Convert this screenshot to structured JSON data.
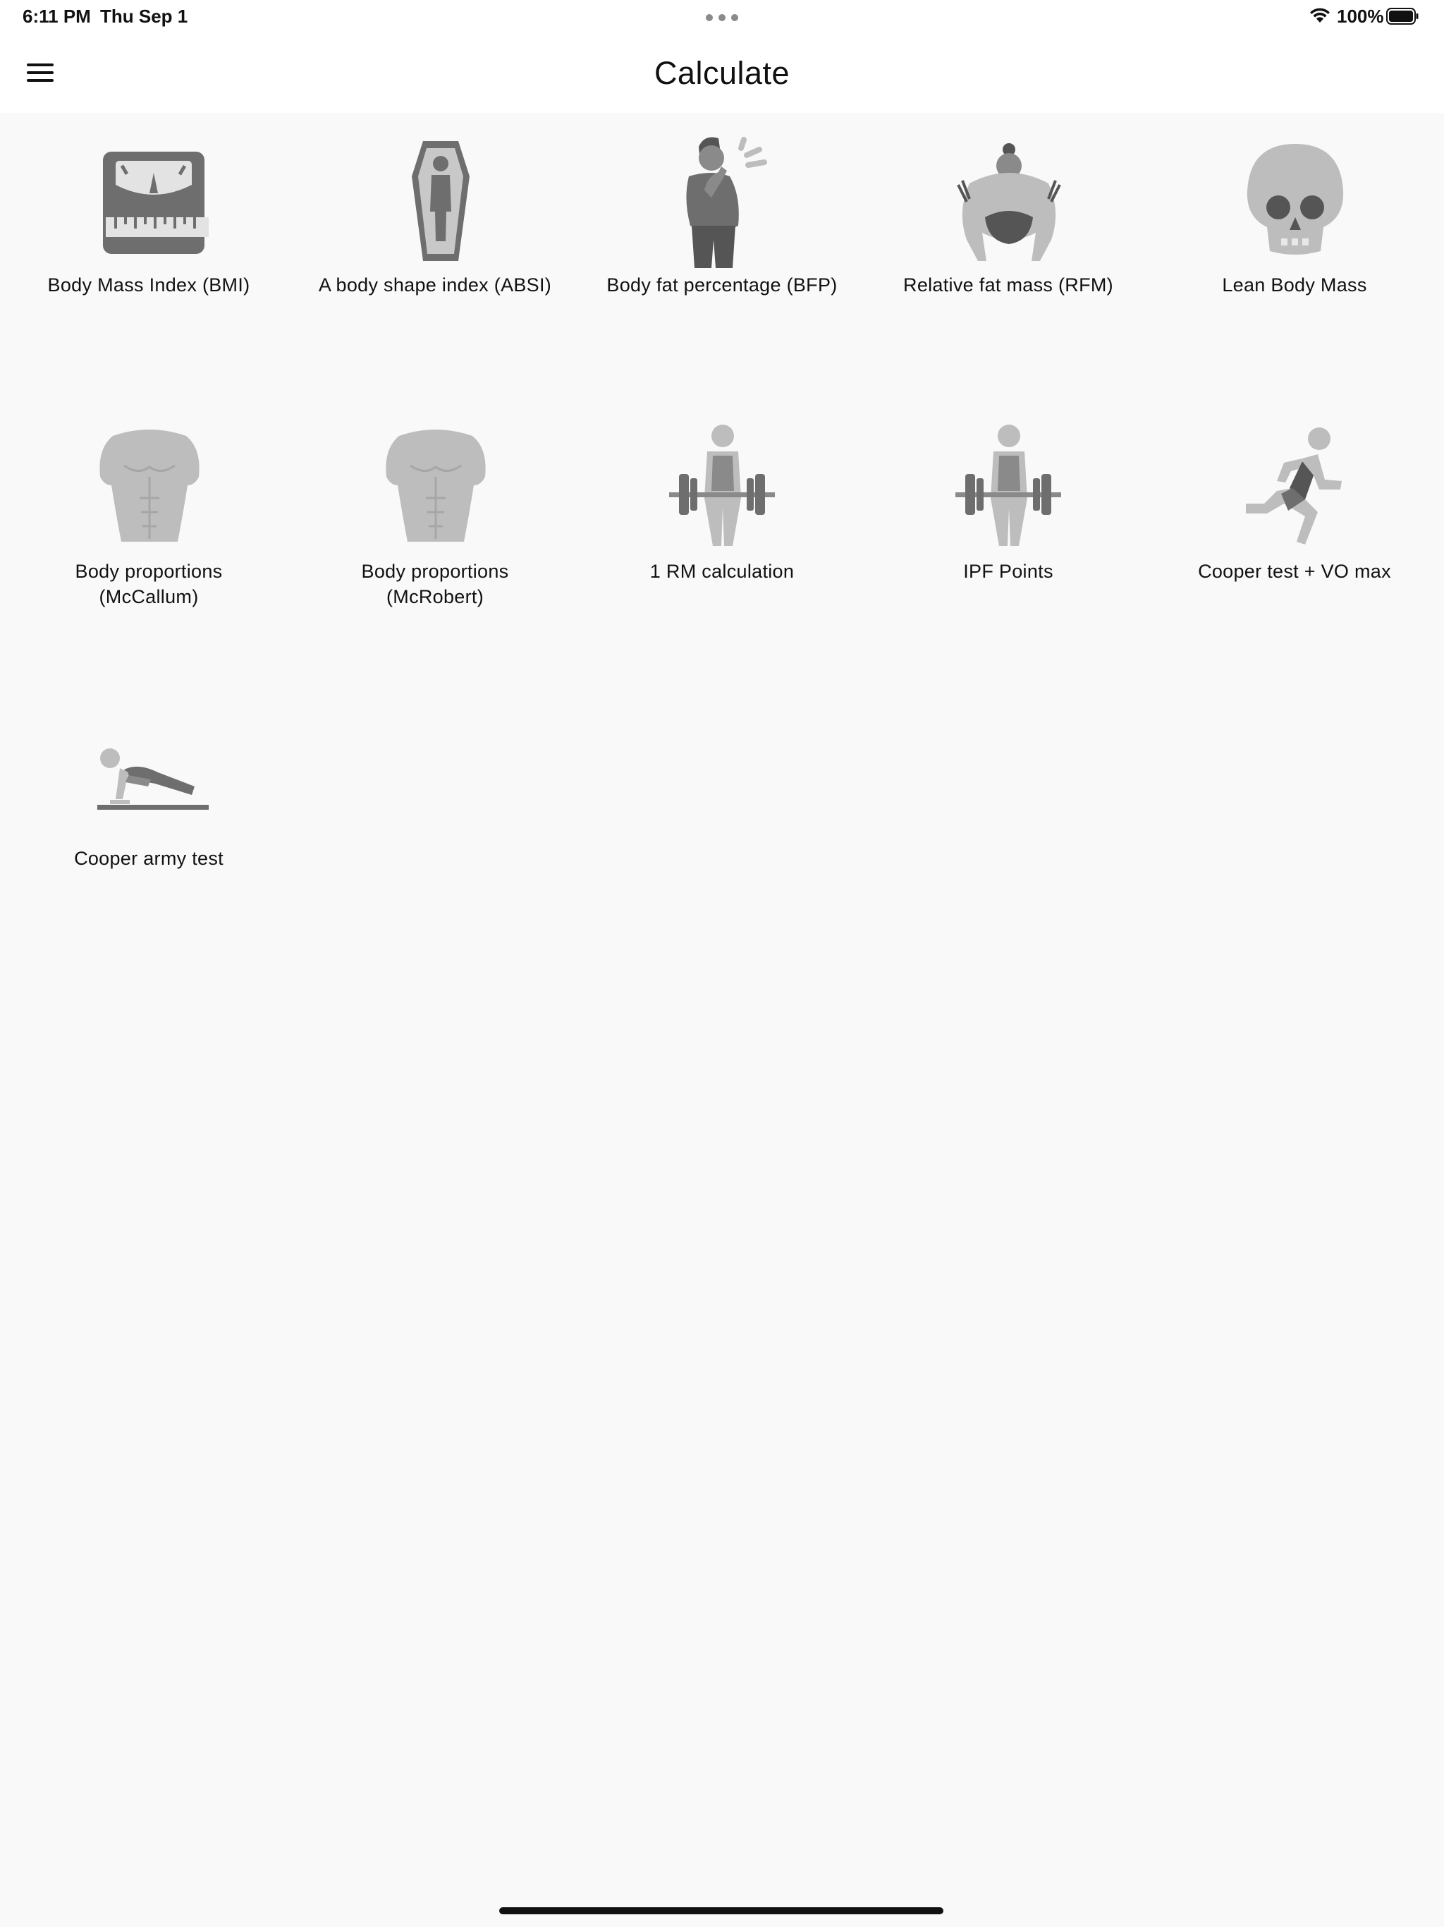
{
  "status_bar": {
    "time": "6:11 PM",
    "date": "Thu Sep 1",
    "battery": "100%"
  },
  "nav": {
    "title": "Calculate"
  },
  "colors": {
    "background": "#f9f9f9",
    "bar": "#ffffff",
    "icon_dark": "#6e6e6e",
    "icon_light": "#bdbdbd"
  },
  "calculators": [
    {
      "label": "Body Mass Index (BMI)",
      "icon": "scale-icon"
    },
    {
      "label": "A body shape index (ABSI)",
      "icon": "coffin-icon"
    },
    {
      "label": "Body fat percentage (BFP)",
      "icon": "eating-person-icon"
    },
    {
      "label": "Relative fat mass (RFM)",
      "icon": "sumo-wrestler-icon"
    },
    {
      "label": "Lean Body Mass",
      "icon": "skull-icon"
    },
    {
      "label": "Body proportions\n(McCallum)",
      "icon": "torso-icon"
    },
    {
      "label": "Body proportions\n(McRobert)",
      "icon": "torso-icon"
    },
    {
      "label": "1 RM calculation",
      "icon": "weightlifter-icon"
    },
    {
      "label": "IPF Points",
      "icon": "weightlifter-icon"
    },
    {
      "label": "Cooper test + VO max",
      "icon": "runner-icon"
    },
    {
      "label": "Cooper army test",
      "icon": "pushup-icon"
    }
  ]
}
